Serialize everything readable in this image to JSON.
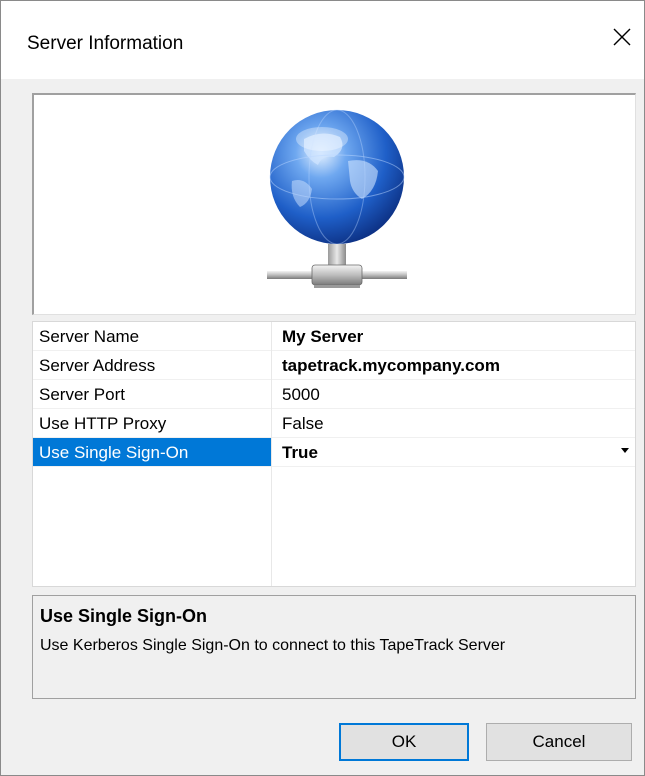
{
  "window": {
    "title": "Server Information",
    "close_icon": "close-icon"
  },
  "image_panel": {
    "icon": "network-globe-icon"
  },
  "properties": [
    {
      "name": "Server Name",
      "value": "My Server",
      "bold": true
    },
    {
      "name": "Server Address",
      "value": "tapetrack.mycompany.com",
      "bold": true
    },
    {
      "name": "Server Port",
      "value": "5000",
      "bold": false
    },
    {
      "name": "Use HTTP Proxy",
      "value": "False",
      "bold": false
    },
    {
      "name": "Use Single Sign-On",
      "value": "True",
      "bold": true,
      "selected": true,
      "has_dropdown": true
    }
  ],
  "help": {
    "title": "Use Single Sign-On",
    "description": "Use Kerberos Single Sign-On to connect to this TapeTrack Server"
  },
  "buttons": {
    "ok": "OK",
    "cancel": "Cancel"
  },
  "colors": {
    "selection": "#0078d7",
    "dialog_bg": "#f0f0f0",
    "globe_blue": "#1f5fc8"
  }
}
